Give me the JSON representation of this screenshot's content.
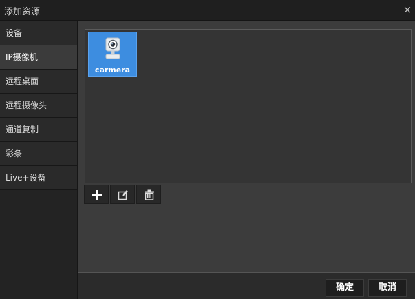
{
  "window": {
    "title": "添加资源",
    "close_glyph": "×"
  },
  "sidebar": {
    "items": [
      {
        "label": "设备",
        "active": false
      },
      {
        "label": "IP摄像机",
        "active": true
      },
      {
        "label": "远程桌面",
        "active": false
      },
      {
        "label": "远程摄像头",
        "active": false
      },
      {
        "label": "通道复制",
        "active": false
      },
      {
        "label": "彩条",
        "active": false
      },
      {
        "label": "Live+设备",
        "active": false
      }
    ]
  },
  "main": {
    "tiles": [
      {
        "label": "carmera",
        "icon": "ip-camera-icon",
        "selected": true
      }
    ],
    "toolbar": {
      "add_icon": "plus-icon",
      "edit_icon": "edit-icon",
      "delete_icon": "trash-icon"
    }
  },
  "footer": {
    "ok_label": "确定",
    "cancel_label": "取消"
  },
  "colors": {
    "accent": "#3d8de0",
    "background": "#2b2b2b",
    "panel": "#3c3c3c"
  }
}
